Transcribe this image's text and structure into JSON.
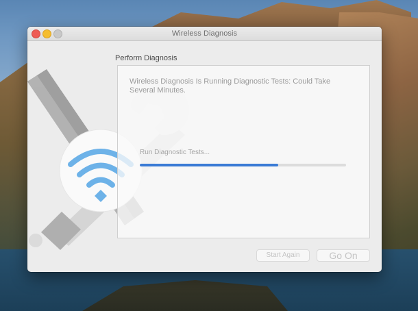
{
  "window": {
    "title": "Wireless Diagnosis",
    "traffic_lights": [
      "close",
      "minimize",
      "maximize"
    ]
  },
  "main": {
    "section_label": "Perform Diagnosis",
    "message": "Wireless Diagnosis Is Running Diagnostic Tests: Could Take Several Minutes.",
    "step_label": "Run Diagnostic Tests...",
    "progress_percent": 67
  },
  "buttons": {
    "start_again": "Start Again",
    "go_on": "Go On"
  },
  "colors": {
    "accent": "#3a7bd5",
    "wifi": "#4aa3e8",
    "close": "#ee5b54",
    "minimize": "#f5bd2f"
  },
  "icons": {
    "illustration": "wifi-wrench-screwdriver-icon"
  }
}
